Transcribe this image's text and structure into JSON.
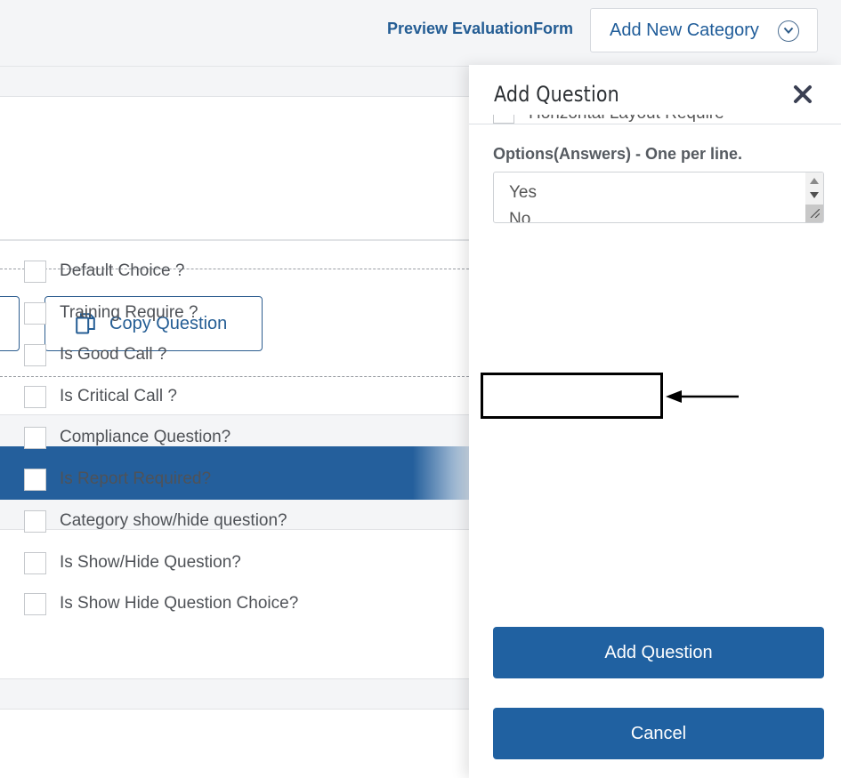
{
  "header": {
    "preview_label": "Preview EvaluationForm",
    "add_category_label": "Add New Category"
  },
  "background": {
    "copy_question_label": "Copy Question"
  },
  "panel": {
    "title": "Add Question",
    "clipped_checkbox_label": "Horizontal Layout Required?",
    "options_label": "Options(Answers) - One per line.",
    "options_lines": [
      "Yes",
      "No"
    ],
    "checkboxes": [
      {
        "label": "Default Choice ?",
        "checked": false
      },
      {
        "label": "Training Require ?",
        "checked": false
      },
      {
        "label": "Is Good Call ?",
        "checked": false
      },
      {
        "label": "Is Critical Call ?",
        "checked": false
      },
      {
        "label": "Compliance Question?",
        "checked": false
      },
      {
        "label": "Is Report Required?",
        "checked": false
      },
      {
        "label": "Category show/hide question?",
        "checked": false
      },
      {
        "label": "Is Show/Hide Question?",
        "checked": false
      },
      {
        "label": "Is Show Hide Question Choice?",
        "checked": false
      }
    ],
    "add_button_label": "Add Question",
    "cancel_button_label": "Cancel"
  },
  "colors": {
    "primary": "#2061a1",
    "link": "#245d94",
    "annotation": "#000000"
  }
}
